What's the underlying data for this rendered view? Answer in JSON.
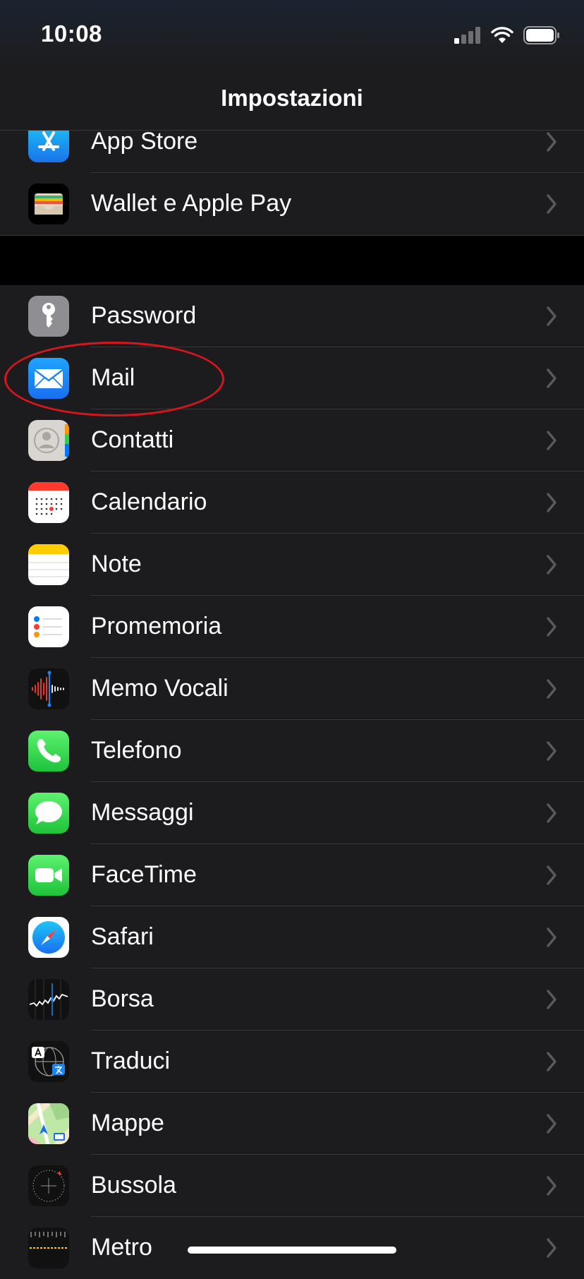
{
  "status_bar": {
    "time": "10:08",
    "signal_icon": "cellular-signal-icon",
    "wifi_icon": "wifi-icon",
    "battery_icon": "battery-icon"
  },
  "header": {
    "title": "Impostazioni"
  },
  "sections": [
    {
      "items": [
        {
          "label": "App Store",
          "icon": "app-store-icon"
        },
        {
          "label": "Wallet e Apple Pay",
          "icon": "wallet-icon"
        }
      ]
    },
    {
      "items": [
        {
          "label": "Password",
          "icon": "key-icon"
        },
        {
          "label": "Mail",
          "icon": "mail-icon"
        },
        {
          "label": "Contatti",
          "icon": "contacts-icon"
        },
        {
          "label": "Calendario",
          "icon": "calendar-icon"
        },
        {
          "label": "Note",
          "icon": "notes-icon"
        },
        {
          "label": "Promemoria",
          "icon": "reminders-icon"
        },
        {
          "label": "Memo Vocali",
          "icon": "voice-memos-icon"
        },
        {
          "label": "Telefono",
          "icon": "phone-icon"
        },
        {
          "label": "Messaggi",
          "icon": "messages-icon"
        },
        {
          "label": "FaceTime",
          "icon": "facetime-icon"
        },
        {
          "label": "Safari",
          "icon": "safari-icon"
        },
        {
          "label": "Borsa",
          "icon": "stocks-icon"
        },
        {
          "label": "Traduci",
          "icon": "translate-icon"
        },
        {
          "label": "Mappe",
          "icon": "maps-icon"
        },
        {
          "label": "Bussola",
          "icon": "compass-icon"
        },
        {
          "label": "Metro",
          "icon": "measure-icon"
        }
      ]
    }
  ],
  "highlighted_item": "Mail",
  "colors": {
    "background": "#1c1c1e",
    "separator": "#38383a",
    "highlight_ring": "#d7151d",
    "chevron": "#5a5a5e"
  }
}
